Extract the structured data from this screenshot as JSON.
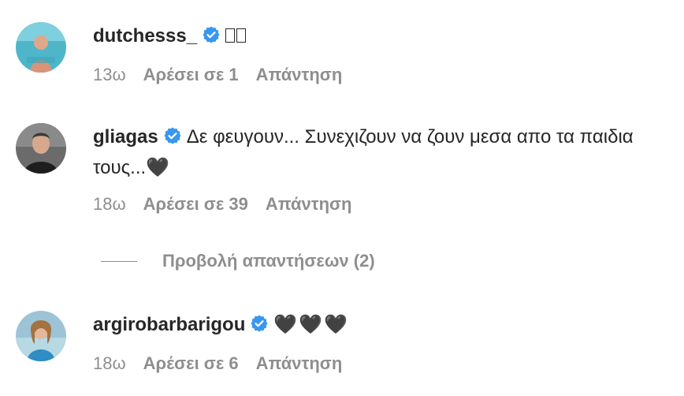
{
  "comments": [
    {
      "username": "dutchesss_",
      "text": "",
      "time": "13ω",
      "likes": "Αρέσει σε 1",
      "reply": "Απάντηση"
    },
    {
      "username": "gliagas",
      "text": "Δε φευγουν... Συνεχιζουν να ζουν μεσα απο τα παιδια τους...🖤",
      "time": "18ω",
      "likes": "Αρέσει σε 39",
      "reply": "Απάντηση"
    },
    {
      "username": "argirobarbarigou",
      "text": "🖤🖤🖤",
      "time": "18ω",
      "likes": "Αρέσει σε 6",
      "reply": "Απάντηση"
    }
  ],
  "view_replies": "Προβολή απαντήσεων (2)",
  "colors": {
    "verified": "#3897f0",
    "meta": "#8e8e8e",
    "text": "#262626"
  },
  "icons": {
    "verified": "verified-badge-icon"
  }
}
